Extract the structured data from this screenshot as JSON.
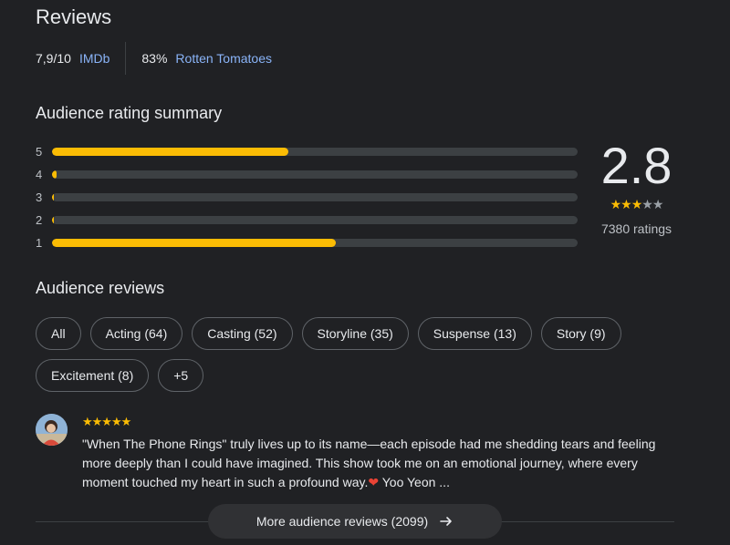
{
  "reviews": {
    "title": "Reviews"
  },
  "sources": [
    {
      "score": "7,9/10",
      "name": "IMDb"
    },
    {
      "score": "83%",
      "name": "Rotten Tomatoes"
    }
  ],
  "rating_summary": {
    "heading": "Audience rating summary",
    "rows": [
      {
        "stars": "5",
        "fraction": 0.45
      },
      {
        "stars": "4",
        "fraction": 0.008
      },
      {
        "stars": "3",
        "fraction": 0.004
      },
      {
        "stars": "2",
        "fraction": 0.004
      },
      {
        "stars": "1",
        "fraction": 0.54
      }
    ],
    "average": "2.8",
    "stars_filled": 3,
    "stars_total": 5,
    "count": "7380 ratings"
  },
  "audience_reviews": {
    "heading": "Audience reviews",
    "chips": [
      "All",
      "Acting (64)",
      "Casting (52)",
      "Storyline (35)",
      "Suspense (13)",
      "Story (9)",
      "Excitement (8)",
      "+5"
    ]
  },
  "review": {
    "stars": "★★★★★",
    "text": "\"When The Phone Rings\" truly lives up to its name—each episode had me shedding tears and feeling more deeply than I could have imagined. This show took me on an emotional journey, where every moment touched my heart in such a profound way.",
    "heart": "❤",
    "text_end": " Yoo Yeon ..."
  },
  "more_button": {
    "label": "More audience reviews (2099)"
  },
  "colors": {
    "accent": "#fbbc04",
    "link": "#8ab4f8",
    "background": "#202124"
  }
}
